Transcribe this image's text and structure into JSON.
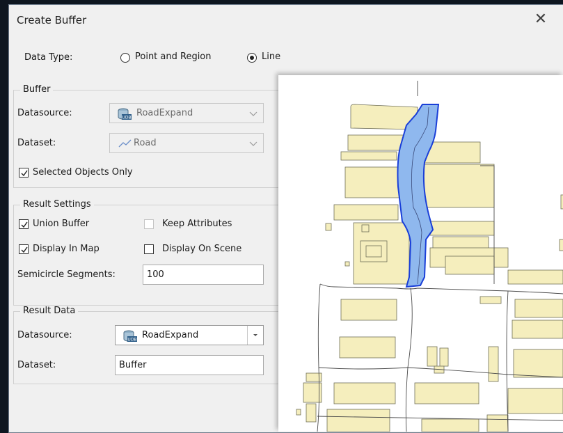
{
  "dialog": {
    "title": "Create Buffer",
    "close_glyph": "✕"
  },
  "data_type": {
    "label": "Data Type:",
    "options": [
      {
        "label": "Point and Region",
        "selected": false
      },
      {
        "label": "Line",
        "selected": true
      }
    ]
  },
  "buffer": {
    "title": "Buffer",
    "datasource_label": "Datasource:",
    "datasource_value": "RoadExpand",
    "dataset_label": "Dataset:",
    "dataset_value": "Road",
    "selected_only_label": "Selected Objects Only",
    "selected_only_checked": true
  },
  "result_settings": {
    "title": "Result Settings",
    "union_buffer_label": "Union Buffer",
    "union_buffer_checked": true,
    "keep_attributes_label": "Keep Attributes",
    "keep_attributes_checked": false,
    "display_in_map_label": "Display In Map",
    "display_in_map_checked": true,
    "display_on_scene_label": "Display On Scene",
    "display_on_scene_checked": false,
    "segments_label": "Semicircle Segments:",
    "segments_value": "100"
  },
  "result_data": {
    "title": "Result Data",
    "datasource_label": "Datasource:",
    "datasource_value": "RoadExpand",
    "dataset_label": "Dataset:",
    "dataset_value": "Buffer"
  },
  "colors": {
    "buffer_fill": "#8fb8ee",
    "buffer_stroke": "#1a3fd8",
    "parcel_fill": "#f5eebd",
    "parcel_stroke": "#6f6f58",
    "road_line": "#4a4a4a"
  },
  "icons": {
    "datasource": "database-udb-icon",
    "dataset": "line-dataset-icon",
    "close": "close-icon",
    "dropdown": "chevron-down-icon"
  }
}
